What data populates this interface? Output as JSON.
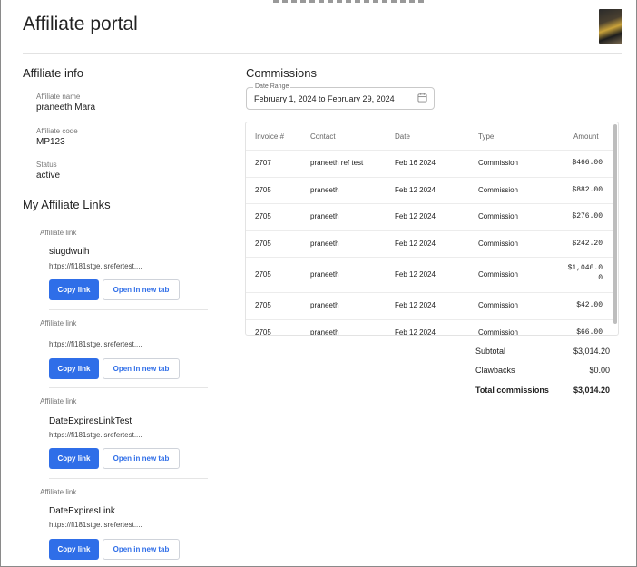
{
  "page": {
    "title": "Affiliate portal"
  },
  "affiliate_info": {
    "section_title": "Affiliate info",
    "name_label": "Affiliate name",
    "name_value": "praneeth Mara",
    "code_label": "Affiliate code",
    "code_value": "MP123",
    "status_label": "Status",
    "status_value": "active"
  },
  "links": {
    "section_title": "My Affiliate Links",
    "items": [
      {
        "label": "Affiliate link",
        "name": "siugdwuih",
        "url": "https://fi181stge.isrefertest....",
        "copy": "Copy link",
        "open": "Open in new tab"
      },
      {
        "label": "Affiliate link",
        "name": "",
        "url": "https://fi181stge.isrefertest....",
        "copy": "Copy link",
        "open": "Open in new tab"
      },
      {
        "label": "Affiliate link",
        "name": "DateExpiresLinkTest",
        "url": "https://fi181stge.isrefertest....",
        "copy": "Copy link",
        "open": "Open in new tab"
      },
      {
        "label": "Affiliate link",
        "name": "DateExpiresLink",
        "url": "https://fi181stge.isrefertest....",
        "copy": "Copy link",
        "open": "Open in new tab"
      }
    ]
  },
  "commissions": {
    "section_title": "Commissions",
    "date_range_label": "Date Range",
    "date_range_value": "February 1, 2024 to February 29, 2024",
    "columns": [
      "Invoice #",
      "Contact",
      "Date",
      "Type",
      "Amount"
    ],
    "rows": [
      {
        "invoice": "2707",
        "contact": "praneeth ref test",
        "date": "Feb 16 2024",
        "type": "Commission",
        "amount": "$466.00"
      },
      {
        "invoice": "2705",
        "contact": "praneeth",
        "date": "Feb 12 2024",
        "type": "Commission",
        "amount": "$882.00"
      },
      {
        "invoice": "2705",
        "contact": "praneeth",
        "date": "Feb 12 2024",
        "type": "Commission",
        "amount": "$276.00"
      },
      {
        "invoice": "2705",
        "contact": "praneeth",
        "date": "Feb 12 2024",
        "type": "Commission",
        "amount": "$242.20"
      },
      {
        "invoice": "2705",
        "contact": "praneeth",
        "date": "Feb 12 2024",
        "type": "Commission",
        "amount_line1": "$1,040.0",
        "amount_line2": "0"
      },
      {
        "invoice": "2705",
        "contact": "praneeth",
        "date": "Feb 12 2024",
        "type": "Commission",
        "amount": "$42.00"
      },
      {
        "invoice": "2705",
        "contact": "praneeth",
        "date": "Feb 12 2024",
        "type": "Commission",
        "amount": "$66.00"
      }
    ],
    "subtotal_label": "Subtotal",
    "subtotal_value": "$3,014.20",
    "clawbacks_label": "Clawbacks",
    "clawbacks_value": "$0.00",
    "total_label": "Total commissions",
    "total_value": "$3,014.20"
  },
  "colors": {
    "primary": "#2f6ee8"
  }
}
